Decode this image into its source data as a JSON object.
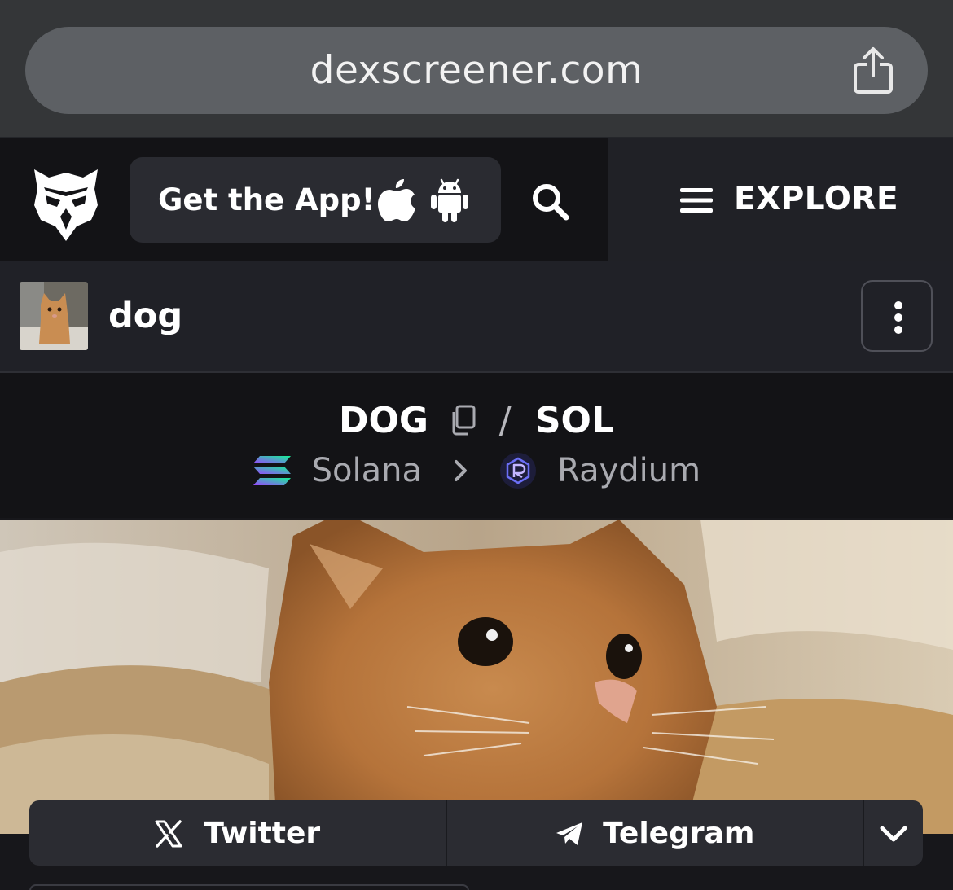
{
  "browser": {
    "url": "dexscreener.com",
    "share_icon": "share-icon"
  },
  "header": {
    "logo_icon": "eagle-logo-icon",
    "get_app_label": "Get the App!",
    "apple_icon": "apple-icon",
    "android_icon": "android-icon",
    "search_icon": "search-icon",
    "explore_label": "EXPLORE",
    "menu_icon": "hamburger-menu-icon"
  },
  "token": {
    "name": "dog",
    "avatar": "cat-photo-avatar",
    "more_icon": "more-vertical-icon"
  },
  "pair": {
    "base": "DOG",
    "separator": "/",
    "quote": "SOL",
    "chain": "Solana",
    "dex": "Raydium",
    "copy_icon": "copy-icon"
  },
  "banner": {
    "image": "orange-cat-in-blankets-photo"
  },
  "socials": {
    "twitter_label": "Twitter",
    "telegram_label": "Telegram",
    "expand_icon": "chevron-down-icon"
  },
  "colors": {
    "browser_bar": "#343638",
    "url_pill": "#5d6064",
    "header_bg": "#131316",
    "button_bg": "#2a2b31",
    "panel_bg": "#202127",
    "muted_text": "#a9aab0"
  }
}
